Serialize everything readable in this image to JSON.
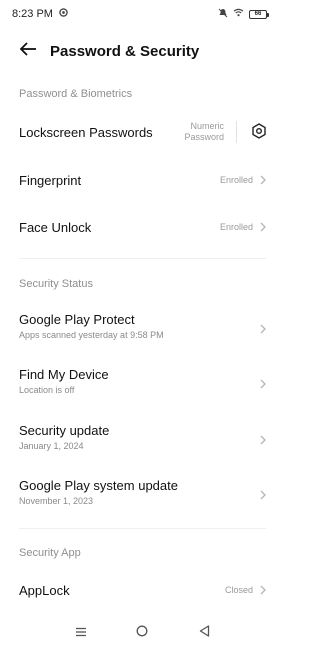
{
  "status_bar": {
    "time": "8:23 PM",
    "battery": "66"
  },
  "header": {
    "title": "Password & Security"
  },
  "sections": {
    "biometrics_label": "Password & Biometrics",
    "security_status_label": "Security Status",
    "security_app_label": "Security App"
  },
  "rows": {
    "lockscreen": {
      "title": "Lockscreen Passwords",
      "value_line1": "Numeric",
      "value_line2": "Password"
    },
    "fingerprint": {
      "title": "Fingerprint",
      "value": "Enrolled"
    },
    "face_unlock": {
      "title": "Face Unlock",
      "value": "Enrolled"
    },
    "play_protect": {
      "title": "Google Play Protect",
      "subtitle": "Apps scanned yesterday at 9:58 PM"
    },
    "find_device": {
      "title": "Find My Device",
      "subtitle": "Location is off"
    },
    "security_update": {
      "title": "Security update",
      "subtitle": "January 1, 2024"
    },
    "play_system_update": {
      "title": "Google Play system update",
      "subtitle": "November 1, 2023"
    },
    "applock": {
      "title": "AppLock",
      "value": "Closed"
    }
  },
  "icons": {
    "back": "arrow-left-icon",
    "shield": "hexagon-icon",
    "chevron": "chevron-right-icon",
    "nav_menu": "menu-icon",
    "nav_home": "home-circle-icon",
    "nav_back": "triangle-back-icon"
  },
  "colors": {
    "section_label": "#8f8f8f",
    "secondary_text": "#9a9a9a",
    "primary_text": "#111111"
  }
}
